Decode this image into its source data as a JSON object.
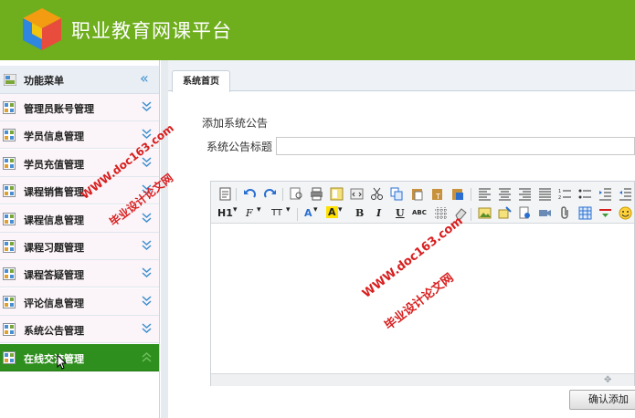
{
  "app": {
    "title": "职业教育网课平台"
  },
  "colors": {
    "header_green": "#6fae1d",
    "active_green": "#2f8f1e",
    "watermark_red": "#d81e1e",
    "accent_blue": "#3a8fd0"
  },
  "sidebar": {
    "header": "功能菜单",
    "collapse_icon": "double-chevron-left-icon",
    "items": [
      {
        "label": "管理员账号管理",
        "active": false
      },
      {
        "label": "学员信息管理",
        "active": false
      },
      {
        "label": "学员充值管理",
        "active": false
      },
      {
        "label": "课程销售管理",
        "active": false
      },
      {
        "label": "课程信息管理",
        "active": false
      },
      {
        "label": "课程习题管理",
        "active": false
      },
      {
        "label": "课程答疑管理",
        "active": false
      },
      {
        "label": "评论信息管理",
        "active": false
      },
      {
        "label": "系统公告管理",
        "active": false
      },
      {
        "label": "在线交流管理",
        "active": true
      }
    ]
  },
  "main": {
    "tab": "系统首页",
    "form_title": "添加系统公告",
    "title_label": "系统公告标题",
    "title_value": "",
    "confirm_label": "确认添加"
  },
  "toolbar": {
    "heading": "H1",
    "font_family": "F",
    "font_size": "TT",
    "font_color": "A",
    "highlight": "A",
    "bold": "B",
    "italic": "I",
    "underline": "U",
    "strike": "ABC"
  },
  "watermark": {
    "url": "WWW.doc163.com",
    "text": "毕业设计论文网"
  }
}
